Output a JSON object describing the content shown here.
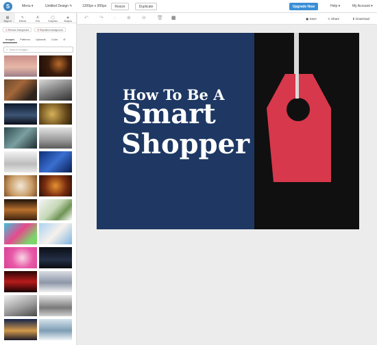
{
  "topbar": {
    "logo_letter": "S",
    "menu": "Menu ▾",
    "design_name": "Untitled Design ✎",
    "size": "1200px x 900px",
    "resize": "Resize",
    "duplicate": "Duplicate",
    "upgrade": "Upgrade Now",
    "help": "Help ▾",
    "account": "My Account ▾"
  },
  "sidebar": {
    "tabs": [
      {
        "label": "Bkgrnd",
        "icon": "▦"
      },
      {
        "label": "Effects",
        "icon": "✎"
      },
      {
        "label": "Text",
        "icon": "A"
      },
      {
        "label": "Graphics",
        "icon": "◯"
      },
      {
        "label": "Shapes",
        "icon": "◈"
      }
    ],
    "remove_bg": "Remove background",
    "reposition_bg": "Reposition background",
    "subtabs": [
      "Images",
      "Patterns",
      "Uploads",
      "Color",
      "⊘"
    ],
    "search_placeholder": "Search Images..."
  },
  "toolbar2": {
    "save": "Save",
    "share": "Share",
    "download": "Download"
  },
  "canvas": {
    "line1": "How To Be A",
    "line2": "Smart",
    "line3": "Shopper",
    "left_color": "#1e3863",
    "right_color": "#101010",
    "tag_color": "#d7384b"
  },
  "thumb_tiles": [
    {
      "name": "pink-sky-photo",
      "bg": "linear-gradient(180deg,#c98f8a 0%,#e7b7a7 55%,#9d7e87 100%)"
    },
    {
      "name": "fire-sparks-photo",
      "bg": "radial-gradient(circle at 60% 40%,#b86a2a 0%,#3a1c0c 45%,#1a0d06 100%)"
    },
    {
      "name": "food-plates-photo",
      "bg": "linear-gradient(135deg,#6b4a2e,#a3673a 40%,#2e241c 80%)"
    },
    {
      "name": "steering-wheel-photo",
      "bg": "linear-gradient(160deg,#d9d9d9,#7f7f7f 50%,#303030)"
    },
    {
      "name": "night-horizon-photo",
      "bg": "linear-gradient(180deg,#0e1a2c,#3d5575 55%,#0a0f18)"
    },
    {
      "name": "gold-bokeh-photo",
      "bg": "radial-gradient(circle at 40% 50%,#d6b25a,#6a4d1d 60%,#2b1f0e)"
    },
    {
      "name": "teal-rocks-photo",
      "bg": "linear-gradient(135deg,#2c4a4f,#7b9fa0 50%,#1e2b2e)"
    },
    {
      "name": "misty-pier-photo",
      "bg": "linear-gradient(180deg,#e3e3e3,#9a9a9a 60%,#5a5a5a)"
    },
    {
      "name": "white-branches-photo",
      "bg": "linear-gradient(180deg,#f2f2f2,#bdbdbd 60%,#e8e8e8)"
    },
    {
      "name": "blue-cubes-photo",
      "bg": "linear-gradient(135deg,#0f2f78,#3a6fd0 50%,#0a1d52)"
    },
    {
      "name": "confetti-table-photo",
      "bg": "radial-gradient(circle at 50% 50%,#f3e8d9,#c79a62 60%,#7d4d28)"
    },
    {
      "name": "orange-bokeh-photo",
      "bg": "radial-gradient(circle at 50% 50%,#e79232,#7a2d10 55%,#2a0f06)"
    },
    {
      "name": "hanging-lights-photo",
      "bg": "linear-gradient(180deg,#1c130b,#b9702d 50%,#3a220f)"
    },
    {
      "name": "palm-leaf-photo",
      "bg": "linear-gradient(135deg,#f4f4f4,#c7d9b8 45%,#6f9455 70%,#ffffff)"
    },
    {
      "name": "piggy-bank-photo",
      "bg": "linear-gradient(135deg,#3fc2d8,#e64a8d 45%,#7cd46a 80%)"
    },
    {
      "name": "blossom-branch-photo",
      "bg": "linear-gradient(135deg,#a9d3f2,#f6f1ec 50%,#7fb4e0)"
    },
    {
      "name": "pink-flower-photo",
      "bg": "radial-gradient(circle at 55% 50%,#f8d7e5,#e85aa8 50%,#d83f96)"
    },
    {
      "name": "star-night-photo",
      "bg": "linear-gradient(180deg,#0a0d14,#243047 60%,#0b0c10)"
    },
    {
      "name": "neon-sign-photo",
      "bg": "linear-gradient(180deg,#2a0505,#b81b1b 50%,#1a0202)"
    },
    {
      "name": "snow-cabin-photo",
      "bg": "linear-gradient(180deg,#d8dbe2,#8e97a8 55%,#f2f2f2)"
    },
    {
      "name": "snowy-hill-photo",
      "bg": "linear-gradient(160deg,#f1f1f1,#9d9d9d 55%,#4a4a4a)"
    },
    {
      "name": "snow-forest-photo",
      "bg": "linear-gradient(180deg,#e6e6e6,#7a7a7a 60%,#d0d0d0)"
    },
    {
      "name": "city-dusk-photo",
      "bg": "linear-gradient(180deg,#14224a,#d29a4b 55%,#1b1b2a)"
    },
    {
      "name": "frozen-lake-photo",
      "bg": "linear-gradient(180deg,#d6e4ec,#7d9db4 55%,#eef3f6)"
    }
  ]
}
